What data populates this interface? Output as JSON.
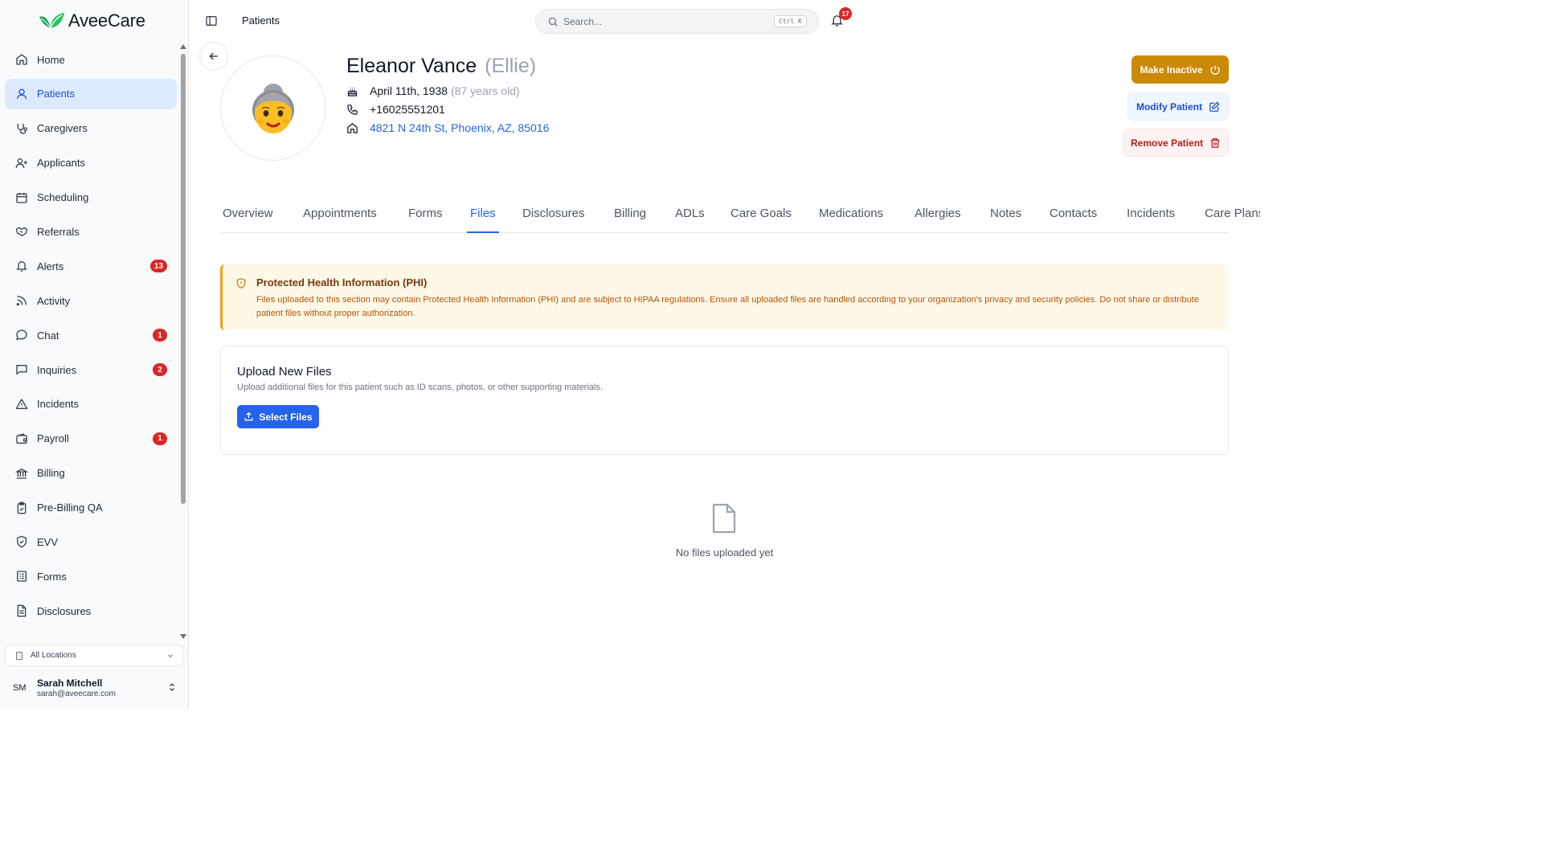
{
  "brand": {
    "name": "AveeCare",
    "accent": "#2563eb",
    "logo_green": "#22a34a"
  },
  "sidebar": {
    "items": [
      {
        "label": "Home",
        "icon": "home-icon"
      },
      {
        "label": "Patients",
        "icon": "user-icon",
        "active": true
      },
      {
        "label": "Caregivers",
        "icon": "stethoscope-icon"
      },
      {
        "label": "Applicants",
        "icon": "user-plus-icon"
      },
      {
        "label": "Scheduling",
        "icon": "calendar-icon"
      },
      {
        "label": "Referrals",
        "icon": "handshake-icon"
      },
      {
        "label": "Alerts",
        "icon": "bell-icon",
        "badge": "13"
      },
      {
        "label": "Activity",
        "icon": "rss-icon"
      },
      {
        "label": "Chat",
        "icon": "chat-bubble-icon",
        "badge": "1"
      },
      {
        "label": "Inquiries",
        "icon": "message-square-icon",
        "badge": "2"
      },
      {
        "label": "Incidents",
        "icon": "warning-triangle-icon"
      },
      {
        "label": "Payroll",
        "icon": "wallet-icon",
        "badge": "1"
      },
      {
        "label": "Billing",
        "icon": "bank-icon"
      },
      {
        "label": "Pre-Billing QA",
        "icon": "clipboard-check-icon"
      },
      {
        "label": "EVV",
        "icon": "shield-check-icon"
      },
      {
        "label": "Forms",
        "icon": "form-icon"
      },
      {
        "label": "Disclosures",
        "icon": "document-icon"
      }
    ],
    "location_select": "All Locations",
    "user": {
      "initials": "SM",
      "name": "Sarah Mitchell",
      "email": "sarah@aveecare.com"
    }
  },
  "topbar": {
    "breadcrumb": "Patients",
    "search_placeholder": "Search...",
    "search_shortcut": "Ctrl K",
    "notifications_count": "17"
  },
  "patient": {
    "name": "Eleanor Vance",
    "nickname": "(Ellie)",
    "dob": "April 11th, 1938",
    "age": "(87 years old)",
    "phone": "+16025551201",
    "address": "4821 N 24th St, Phoenix, AZ, 85016"
  },
  "actions": {
    "make_inactive": "Make Inactive",
    "modify": "Modify Patient",
    "remove": "Remove Patient"
  },
  "tabs": [
    {
      "label": "Overview"
    },
    {
      "label": "Appointments"
    },
    {
      "label": "Forms"
    },
    {
      "label": "Files",
      "active": true
    },
    {
      "label": "Disclosures"
    },
    {
      "label": "Billing"
    },
    {
      "label": "ADLs"
    },
    {
      "label": "Care Goals"
    },
    {
      "label": "Medications"
    },
    {
      "label": "Allergies"
    },
    {
      "label": "Notes"
    },
    {
      "label": "Contacts"
    },
    {
      "label": "Incidents"
    },
    {
      "label": "Care Plans"
    }
  ],
  "phi_notice": {
    "title": "Protected Health Information (PHI)",
    "body": "Files uploaded to this section may contain Protected Health Information (PHI) and are subject to HIPAA regulations. Ensure all uploaded files are handled according to your organization's privacy and security policies. Do not share or distribute patient files without proper authorization."
  },
  "upload": {
    "title": "Upload New Files",
    "description": "Upload additional files for this patient such as ID scans, photos, or other supporting materials.",
    "button": "Select Files"
  },
  "empty_state": {
    "text": "No files uploaded yet"
  }
}
